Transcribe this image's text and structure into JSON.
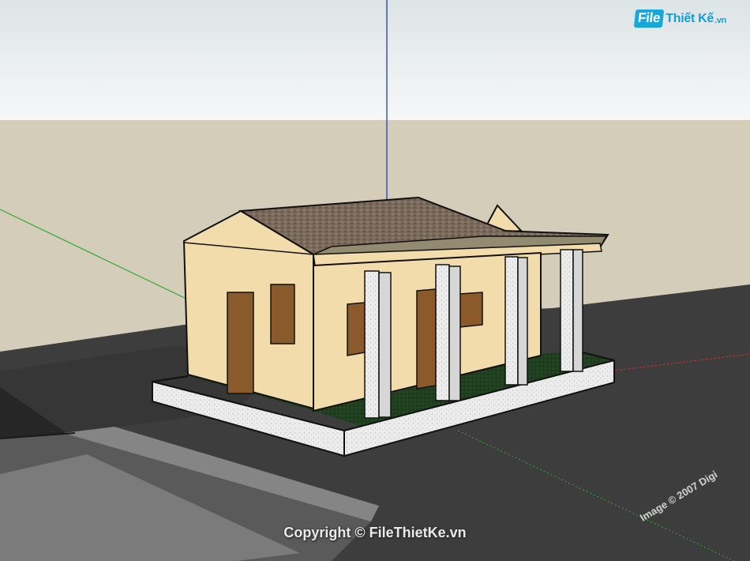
{
  "watermark": {
    "logo_badge": "File",
    "logo_name": "Thiết Kế",
    "logo_tld": ".vn",
    "copyright": "Copyright © FileThietKe.vn",
    "brand_color": "#17a7d8"
  },
  "viewport": {
    "image_credit": "Image © 2007 Digi",
    "sky_color": "#f3f6f6",
    "ground_color": "#d3cdba",
    "terrain_color": "#3d3d3d",
    "axis_colors": {
      "blue_axis": "#2a35c8",
      "green_axis": "#2eaa2e",
      "red_axis": "#c83232"
    }
  },
  "model": {
    "wall_color": "#f3dcab",
    "roof_color": "#7a6a5c",
    "door_color": "#8a5a2a",
    "column_color": "#e6e6e6",
    "lawn_color": "#1f3f1f"
  }
}
